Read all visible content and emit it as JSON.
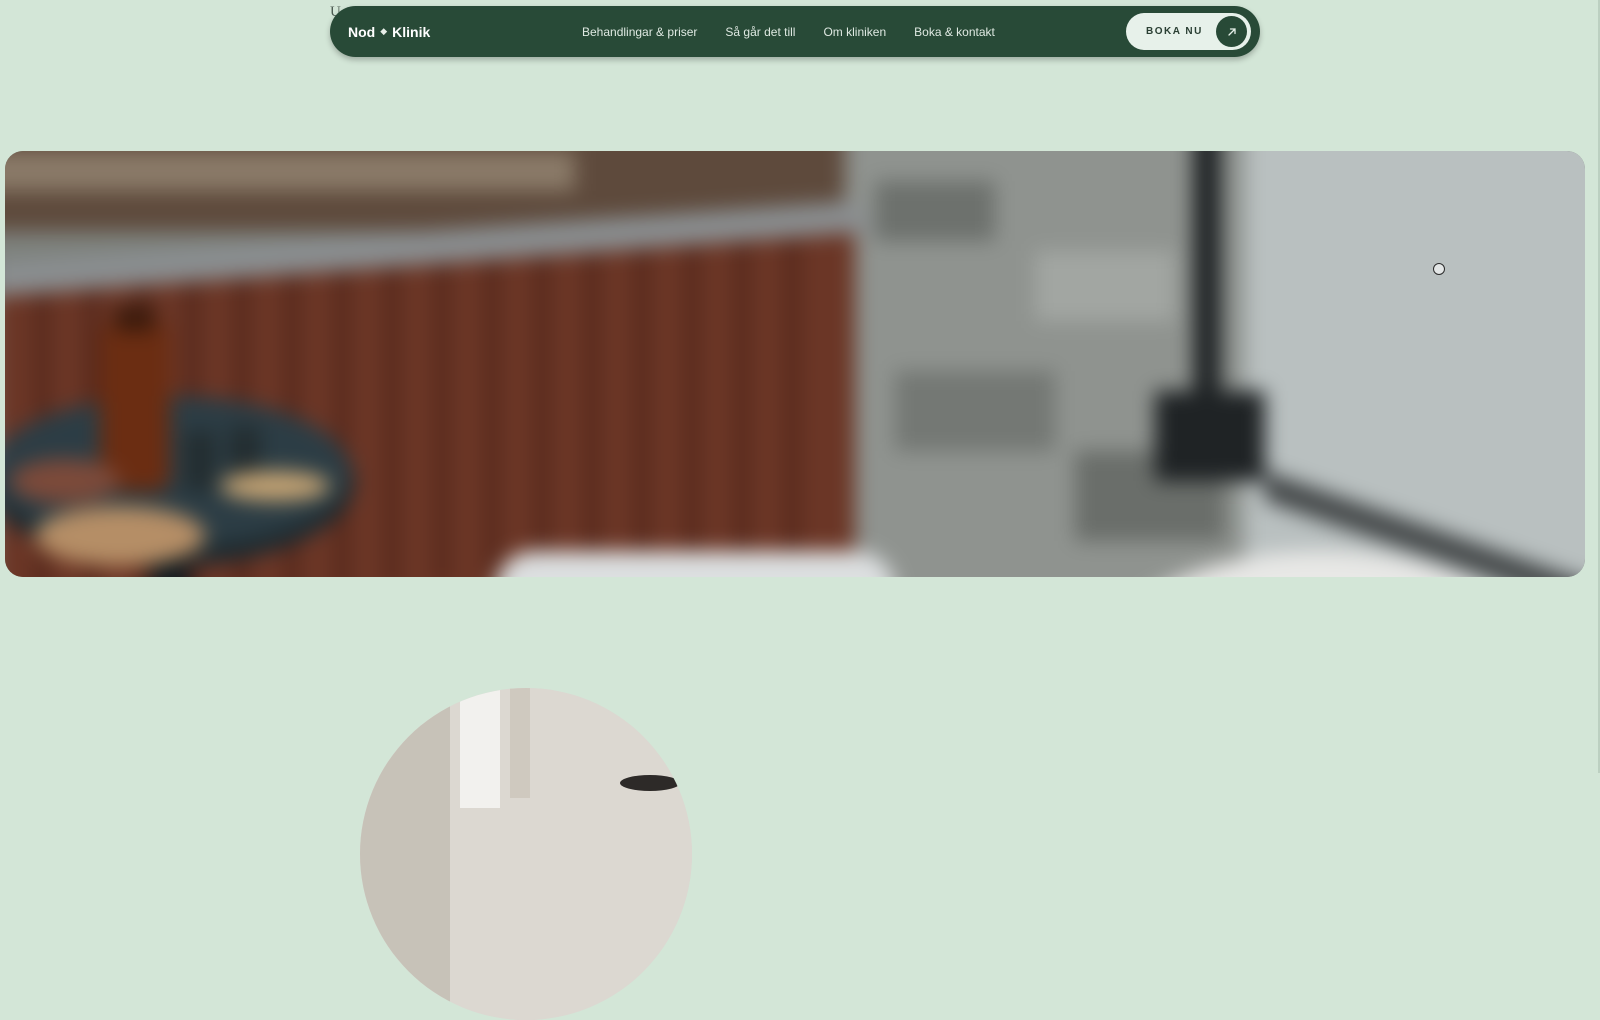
{
  "stray_mark": "U",
  "nav": {
    "logo": {
      "left": "Nod",
      "separator": "◆",
      "right": "Klinik"
    },
    "links": [
      {
        "label": "Behandlingar & priser"
      },
      {
        "label": "Så går det till"
      },
      {
        "label": "Om kliniken"
      },
      {
        "label": "Boka & kontakt"
      }
    ],
    "cta": {
      "label": "BOKA NU",
      "icon": "arrow-up-right-icon"
    }
  },
  "hero": {
    "image": "blurred-treatment-room-photo"
  },
  "section_image": "round-clinic-photo",
  "colors": {
    "background": "#d3e6d7",
    "nav_background": "#284a37",
    "cta_background": "#e7f1ea"
  }
}
